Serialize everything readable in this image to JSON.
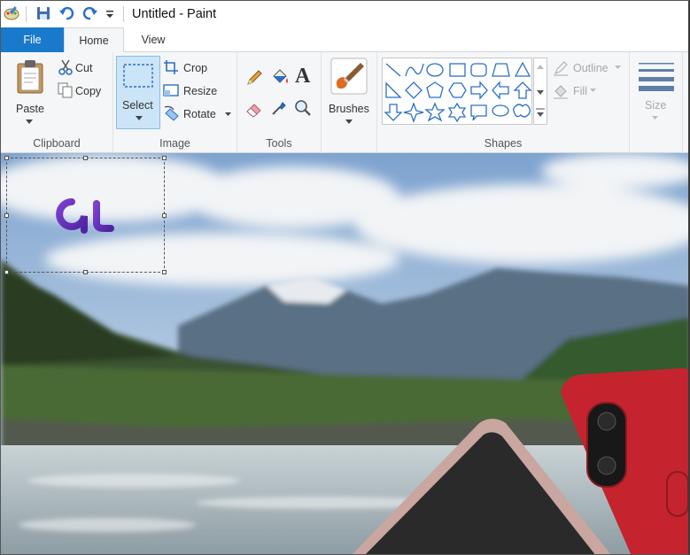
{
  "window": {
    "title": "Untitled - Paint"
  },
  "tabs": {
    "file": "File",
    "home": "Home",
    "view": "View"
  },
  "clipboard": {
    "paste": "Paste",
    "cut": "Cut",
    "copy": "Copy",
    "group": "Clipboard"
  },
  "image": {
    "select": "Select",
    "crop": "Crop",
    "resize": "Resize",
    "rotate": "Rotate",
    "group": "Image"
  },
  "tools": {
    "group": "Tools"
  },
  "brushes": {
    "label": "Brushes"
  },
  "shapes": {
    "outline": "Outline",
    "fill": "Fill",
    "group": "Shapes"
  },
  "size": {
    "label": "Size"
  },
  "colors": {
    "accent": "#1979ca",
    "selection_highlight": "#cce4f7",
    "logo": "#6a34b8"
  }
}
